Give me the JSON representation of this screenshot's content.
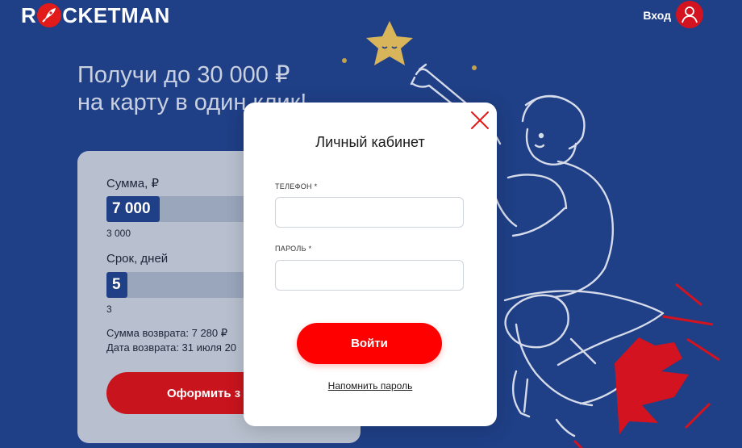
{
  "header": {
    "logo": {
      "prefix": "R",
      "suffix": "CKETMAN"
    },
    "login_label": "Вход"
  },
  "hero": {
    "title_line1": "Получи до 30 000 ₽",
    "title_line2": "на карту в один клик!"
  },
  "calculator": {
    "sum_label": "Сумма, ₽",
    "sum_value": "7 000",
    "sum_min": "3 000",
    "term_label": "Срок, дней",
    "term_value": "5",
    "term_min": "3",
    "return_sum": "Сумма возврата: 7 280 ₽",
    "return_date": "Дата возврата: 31 июля 20",
    "cta_label": "Оформить з"
  },
  "modal": {
    "title": "Личный кабинет",
    "phone_label": "ТЕЛЕФОН *",
    "phone_value": "",
    "password_label": "ПАРОЛЬ *",
    "password_value": "",
    "submit_label": "Войти",
    "remind_label": "Напомнить пароль"
  },
  "colors": {
    "background": "#1f3f86",
    "accent_red": "#ff0000",
    "star": "#d8b45a",
    "card": "#b8c0cf"
  },
  "icons": {
    "logo_badge": "rocket-icon",
    "avatar": "user-icon",
    "close": "close-icon"
  }
}
